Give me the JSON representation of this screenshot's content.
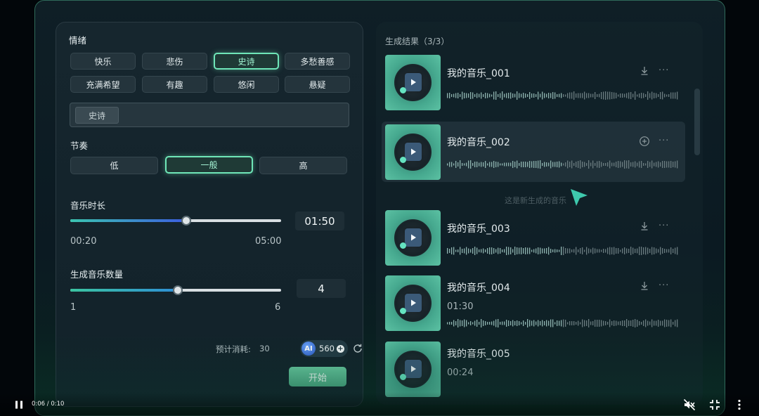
{
  "left": {
    "mood_title": "情绪",
    "moods": [
      "快乐",
      "悲伤",
      "史诗",
      "多愁善感",
      "充满希望",
      "有趣",
      "悠闲",
      "悬疑"
    ],
    "selected_mood_index": 2,
    "selected_tags": [
      "史诗"
    ],
    "tempo_title": "节奏",
    "tempos": [
      "低",
      "一般",
      "高"
    ],
    "selected_tempo_index": 1,
    "duration": {
      "title": "音乐时长",
      "min": "00:20",
      "max": "05:00",
      "value": "01:50",
      "fraction": 0.55
    },
    "count": {
      "title": "生成音乐数量",
      "min": "1",
      "max": "6",
      "value": "4",
      "fraction": 0.51
    },
    "cost_label": "预计消耗:",
    "cost_value": "30",
    "credit_badge": "AI",
    "credits": "560",
    "start_label": "开始",
    "icons": {
      "add": "plus-circle-icon",
      "refresh": "refresh-icon"
    },
    "colors": {
      "accent": "#6fe6b8",
      "start": "#58b890"
    }
  },
  "right": {
    "results_title": "生成结果（3/3）",
    "hint": "这是新生成的音乐",
    "tracks": [
      {
        "title": "我的音乐_001",
        "time": "",
        "action_icon": "download-icon"
      },
      {
        "title": "我的音乐_002",
        "time": "",
        "action_icon": "add-circle-icon"
      },
      {
        "title": "我的音乐_003",
        "time": "",
        "action_icon": "download-icon"
      },
      {
        "title": "我的音乐_004",
        "time": "01:30",
        "action_icon": "download-icon"
      },
      {
        "title": "我的音乐_005",
        "time": "00:24",
        "action_icon": ""
      }
    ]
  },
  "video": {
    "time": "0:06 / 0:10",
    "icons": [
      "pause-icon",
      "mute-icon",
      "exit-fullscreen-icon",
      "more-vert-icon"
    ]
  }
}
